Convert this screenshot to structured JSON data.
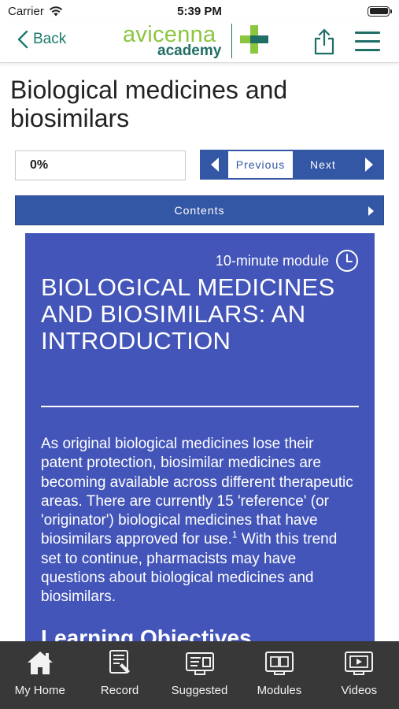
{
  "status_bar": {
    "carrier": "Carrier",
    "time": "5:39 PM"
  },
  "nav": {
    "back_label": "Back",
    "logo_word": "avicenna",
    "logo_sub": "academy"
  },
  "page": {
    "title": "Biological medicines and biosimilars"
  },
  "progress": {
    "label": "0%",
    "value": 0
  },
  "pager": {
    "previous_label": "Previous",
    "next_label": "Next"
  },
  "contents": {
    "label": "Contents"
  },
  "module": {
    "duration": "10-minute module",
    "heading": "BIOLOGICAL MEDICINES AND BIOSIMILARS: AN INTRODUCTION",
    "body_part1": "As original biological medicines lose their patent protection, biosimilar medicines are becoming available across different therapeutic areas. There are currently 15 'reference' (or 'originator') biological medicines that have biosimilars approved for use.",
    "body_ref": "1",
    "body_part2": " With this trend set to continue, pharmacists may have questions about biological medicines and biosimilars.",
    "subheading": "Learning Objectives"
  },
  "tabs": [
    {
      "label": "My Home",
      "icon": "home-icon"
    },
    {
      "label": "Record",
      "icon": "record-icon"
    },
    {
      "label": "Suggested",
      "icon": "suggested-icon"
    },
    {
      "label": "Modules",
      "icon": "modules-icon"
    },
    {
      "label": "Videos",
      "icon": "videos-icon"
    }
  ],
  "colors": {
    "brand_green": "#8cc63f",
    "brand_teal": "#1f6f66",
    "accent_blue": "#3356a5",
    "card_blue": "#4355b9",
    "tab_bar": "#383838"
  }
}
